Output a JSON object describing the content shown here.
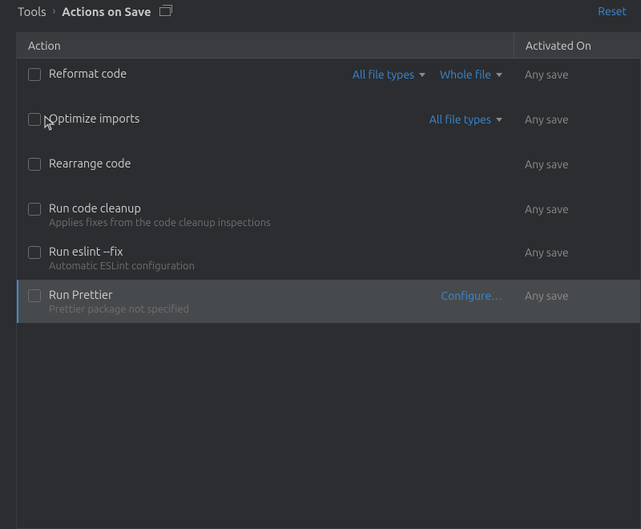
{
  "breadcrumb": {
    "parent": "Tools",
    "current": "Actions on Save"
  },
  "reset_label": "Reset",
  "table": {
    "header_action": "Action",
    "header_activated": "Activated On"
  },
  "rows": [
    {
      "label": "Reformat code",
      "sublabel": "",
      "opt1": "All file types",
      "opt2": "Whole file",
      "configure": "",
      "activated": "Any save",
      "selected": false,
      "tall": true
    },
    {
      "label": "Optimize imports",
      "sublabel": "",
      "opt1": "All file types",
      "opt2": "",
      "configure": "",
      "activated": "Any save",
      "selected": false,
      "tall": true
    },
    {
      "label": "Rearrange code",
      "sublabel": "",
      "opt1": "",
      "opt2": "",
      "configure": "",
      "activated": "Any save",
      "selected": false,
      "tall": true
    },
    {
      "label": "Run code cleanup",
      "sublabel": "Applies fixes from the code cleanup inspections",
      "opt1": "",
      "opt2": "",
      "configure": "",
      "activated": "Any save",
      "selected": false,
      "tall": false
    },
    {
      "label": "Run eslint --fix",
      "sublabel": "Automatic ESLint configuration",
      "opt1": "",
      "opt2": "",
      "configure": "",
      "activated": "Any save",
      "selected": false,
      "tall": false
    },
    {
      "label": "Run Prettier",
      "sublabel": "Prettier package not specified",
      "opt1": "",
      "opt2": "",
      "configure": "Configure…",
      "activated": "Any save",
      "selected": true,
      "tall": false
    }
  ]
}
